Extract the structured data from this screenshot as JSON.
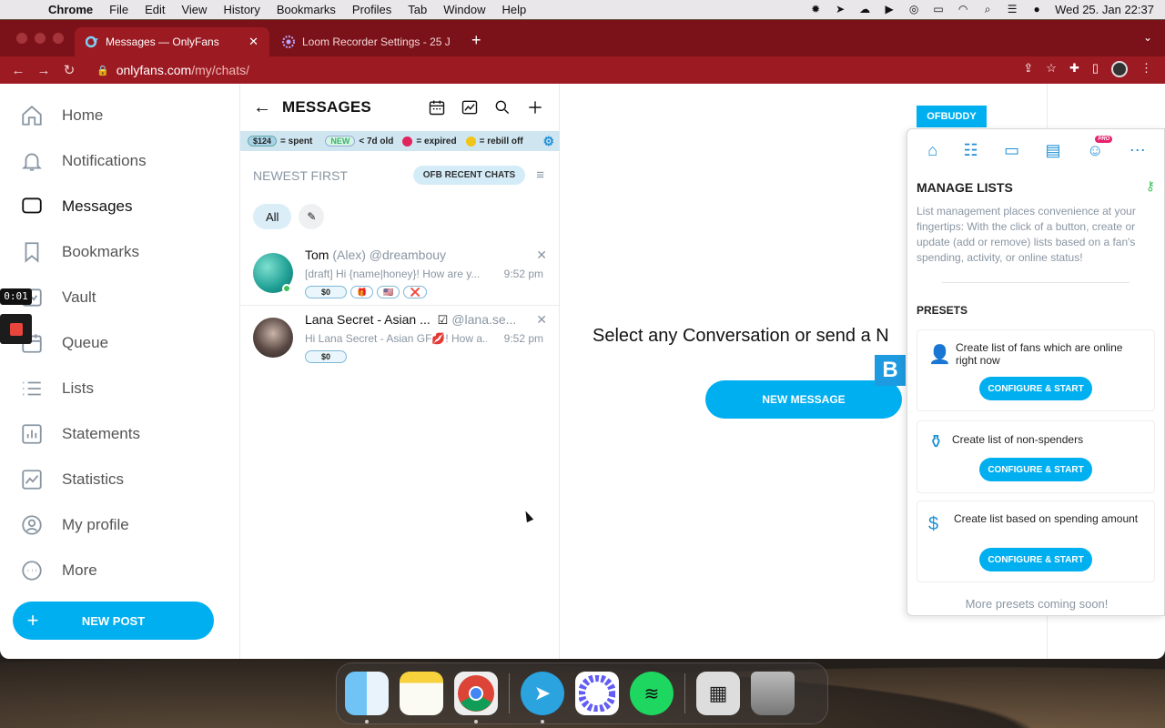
{
  "menubar": {
    "app": "Chrome",
    "items": [
      "File",
      "Edit",
      "View",
      "History",
      "Bookmarks",
      "Profiles",
      "Tab",
      "Window",
      "Help"
    ],
    "clock": "Wed 25. Jan  22:37"
  },
  "browser": {
    "tabs": [
      {
        "title": "Messages — OnlyFans",
        "active": true
      },
      {
        "title": "Loom Recorder Settings - 25 J",
        "active": false
      }
    ],
    "url_domain": "onlyfans.com",
    "url_path": "/my/chats/"
  },
  "recorder": {
    "time": "0:01"
  },
  "sidebar": {
    "items": [
      {
        "label": "Home",
        "icon": "home-icon"
      },
      {
        "label": "Notifications",
        "icon": "bell-icon"
      },
      {
        "label": "Messages",
        "icon": "message-icon"
      },
      {
        "label": "Bookmarks",
        "icon": "bookmark-icon"
      },
      {
        "label": "Vault",
        "icon": "vault-icon"
      },
      {
        "label": "Queue",
        "icon": "calendar-icon"
      },
      {
        "label": "Lists",
        "icon": "list-icon"
      },
      {
        "label": "Statements",
        "icon": "statements-icon"
      },
      {
        "label": "Statistics",
        "icon": "statistics-icon"
      },
      {
        "label": "My profile",
        "icon": "profile-icon"
      },
      {
        "label": "More",
        "icon": "more-icon"
      }
    ],
    "new_post": "NEW POST"
  },
  "messages": {
    "title": "MESSAGES",
    "legend": {
      "spent_pill": "$124",
      "spent_label": "= spent",
      "new_pill": "NEW",
      "new_label": "< 7d old",
      "expired_label": "= expired",
      "rebill_label": "= rebill off",
      "expired_color": "#e0245e",
      "rebill_color": "#f0c419"
    },
    "sort_label": "NEWEST FIRST",
    "ofb_button": "OFB RECENT CHATS",
    "filter_chip": "All",
    "chats": [
      {
        "name": "Tom",
        "sub": "(Alex) @dreambouy",
        "preview": "[draft]  Hi {name|honey}! How are y...",
        "time": "9:52 pm",
        "amount": "$0",
        "tags": [
          "🎁",
          "🇺🇸",
          "❌"
        ]
      },
      {
        "name": "Lana Secret - Asian ...",
        "sub": "@lana.se...",
        "preview": "Hi Lana Secret - Asian GF💋! How a...",
        "time": "9:52 pm",
        "amount": "$0",
        "tags": []
      }
    ]
  },
  "center": {
    "prompt": "Select any Conversation or send a N",
    "new_message": "NEW MESSAGE"
  },
  "ofb": {
    "badge": "OFBUDDY",
    "pro": "PRO",
    "title": "MANAGE LISTS",
    "description": "List management places convenience at your fingertips: With the click of a button, create or update (add or remove) lists based on a fan's spending, activity, or online status!",
    "presets_title": "PRESETS",
    "presets": [
      {
        "text": "Create list of fans which are online right now",
        "button": "CONFIGURE & START"
      },
      {
        "text": "Create list of non-spenders",
        "button": "CONFIGURE & START"
      },
      {
        "text": "Create list based on spending amount",
        "button": "CONFIGURE & START"
      }
    ],
    "more": "More presets coming soon!"
  },
  "dock": [
    "Finder",
    "Notes",
    "Chrome",
    "Telegram",
    "Loom",
    "Spotify",
    "Preview",
    "Trash"
  ]
}
